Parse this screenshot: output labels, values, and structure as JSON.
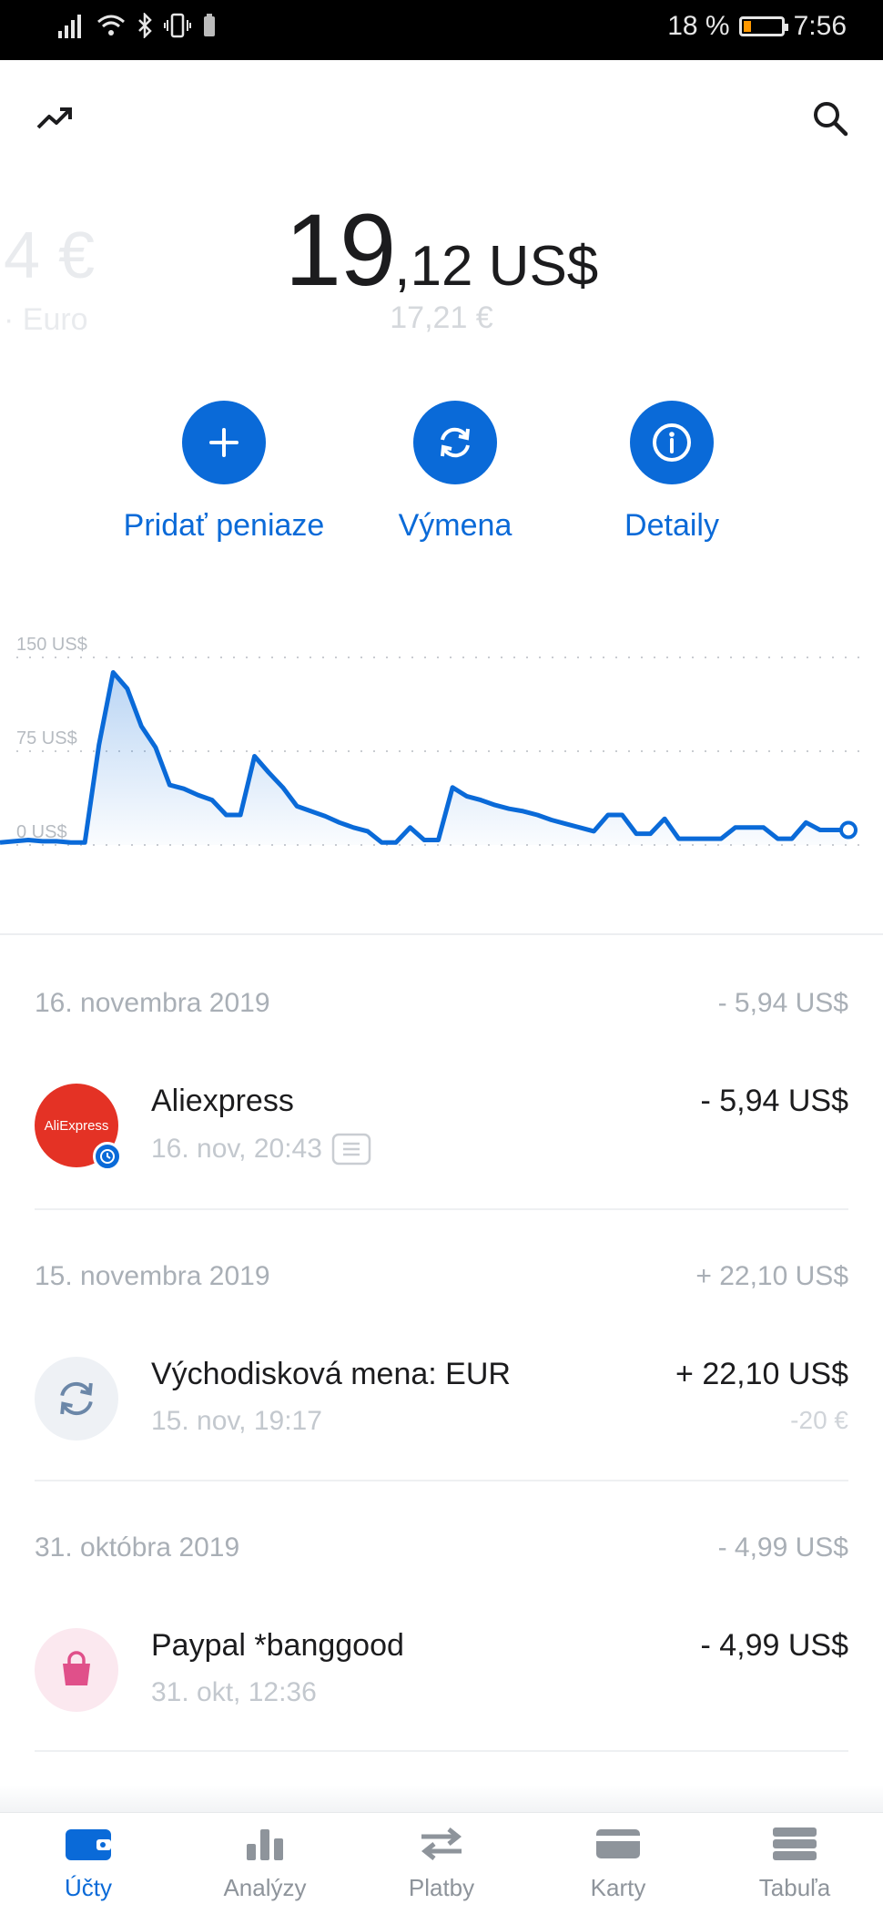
{
  "status_bar": {
    "battery": "18 %",
    "time": "7:56"
  },
  "header": {
    "left_icon": "trending-up-icon",
    "right_icon": "search-icon"
  },
  "balance": {
    "prev_amount": "4 €",
    "prev_currency": "· Euro",
    "integer": "19",
    "fraction": ",12 US$",
    "converted": "17,21 €"
  },
  "actions": [
    {
      "label": "Pridať peniaze",
      "icon": "plus-icon"
    },
    {
      "label": "Výmena",
      "icon": "exchange-icon"
    },
    {
      "label": "Detaily",
      "icon": "info-icon"
    }
  ],
  "chart_data": {
    "type": "area",
    "y_ticks": [
      "150 US$",
      "75 US$",
      "0 US$"
    ],
    "ylim": [
      0,
      150
    ],
    "grid": true,
    "color": "#0a6ad8",
    "values": [
      2,
      3,
      4,
      3,
      3,
      2,
      2,
      80,
      138,
      125,
      95,
      78,
      48,
      45,
      40,
      36,
      24,
      24,
      71,
      58,
      46,
      31,
      27,
      23,
      18,
      14,
      11,
      2,
      2,
      14,
      4,
      4,
      46,
      39,
      36,
      32,
      29,
      27,
      24,
      20,
      17,
      14,
      11,
      24,
      24,
      9,
      9,
      21,
      5,
      5,
      5,
      5,
      14,
      14,
      14,
      5,
      5,
      18,
      12,
      12,
      12
    ]
  },
  "transactions": [
    {
      "date": "16. novembra 2019",
      "day_total": "- 5,94 US$",
      "title": "Aliexpress",
      "subtitle": "16. nov, 20:43",
      "amount": "- 5,94 US$",
      "logo_text": "AliExpress"
    },
    {
      "date": "15. novembra 2019",
      "day_total": "+ 22,10 US$",
      "title": "Východisková mena: EUR",
      "subtitle": "15. nov, 19:17",
      "amount": "+ 22,10 US$",
      "amount_secondary": "-20 €"
    },
    {
      "date": "31. októbra 2019",
      "day_total": "- 4,99 US$",
      "title": "Paypal *banggood",
      "subtitle": "31. okt, 12:36",
      "amount": "- 4,99 US$"
    }
  ],
  "nav": [
    {
      "label": "Účty",
      "icon": "wallet-icon",
      "active": true
    },
    {
      "label": "Analýzy",
      "icon": "bar-chart-icon",
      "active": false
    },
    {
      "label": "Platby",
      "icon": "transfer-arrows-icon",
      "active": false
    },
    {
      "label": "Karty",
      "icon": "card-icon",
      "active": false
    },
    {
      "label": "Tabuľa",
      "icon": "dashboard-icon",
      "active": false
    }
  ]
}
